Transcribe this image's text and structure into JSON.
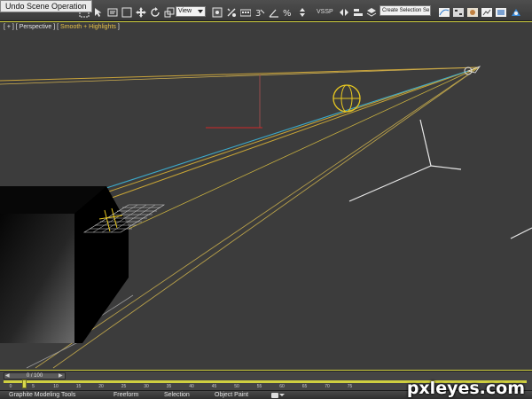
{
  "toolbar": {
    "undo_tooltip": "Undo Scene Operation",
    "view_dropdown_value": "View",
    "viewport_shading_label": "VSSP",
    "selection_set_value": "Create Selection Se",
    "icons": [
      "select-region-icon",
      "select-move-icon",
      "select-rotate-icon",
      "select-scale-icon",
      "snap-icon",
      "angle-snap-icon",
      "percent-snap-icon",
      "mirror-icon",
      "align-icon",
      "layer-manager-icon",
      "render-setup-icon",
      "rendered-frame-icon",
      "render-icon"
    ]
  },
  "viewport": {
    "label_prefix": "[ + ] [",
    "label_view": "Perspective",
    "label_mid": "] [",
    "label_shading": "Smooth + Highlights",
    "label_suffix": "]",
    "border_color": "#cfcf40",
    "background_color": "#3c3c3c"
  },
  "timeline": {
    "slider_value": "0 / 100",
    "tick_labels": [
      "0",
      "5",
      "10",
      "15",
      "20",
      "25",
      "30",
      "35",
      "40",
      "45",
      "50",
      "55",
      "60",
      "65",
      "70",
      "75"
    ]
  },
  "ribbon": {
    "tabs": [
      "Graphite Modeling Tools",
      "Freeform",
      "Selection",
      "Object Paint"
    ]
  },
  "watermark": "pxleyes.com"
}
